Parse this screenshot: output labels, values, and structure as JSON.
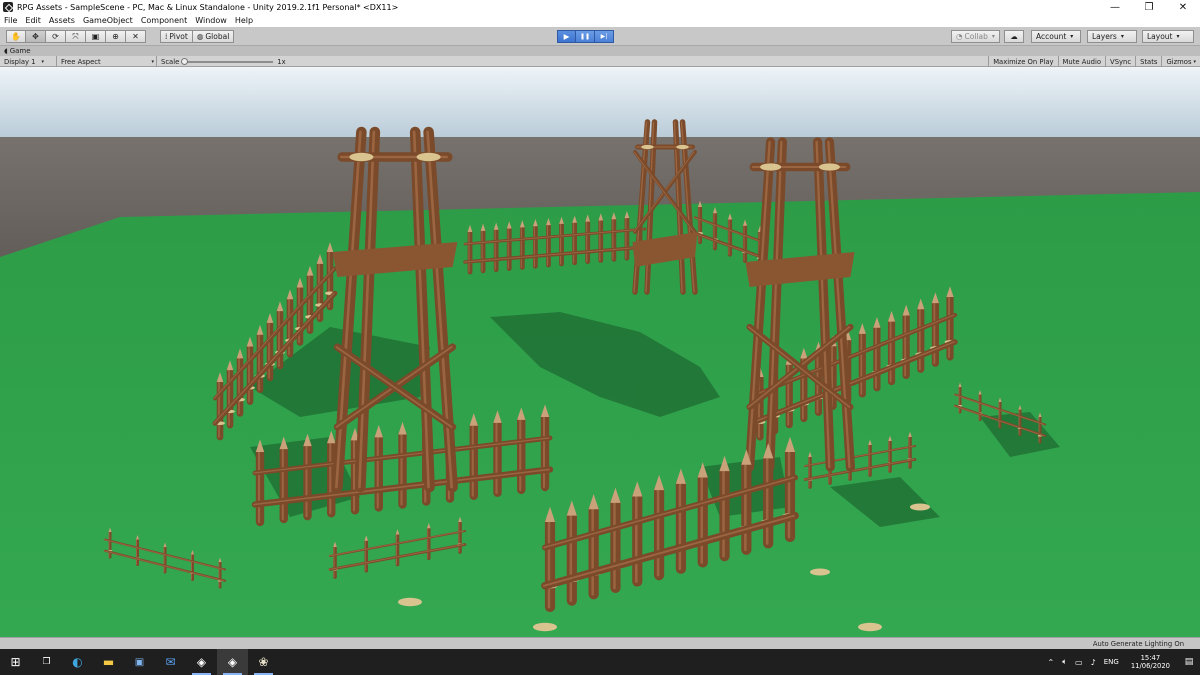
{
  "window": {
    "title": "RPG Assets - SampleScene - PC, Mac & Linux Standalone - Unity 2019.2.1f1 Personal* <DX11>",
    "controls": {
      "minimize": "—",
      "restore": "❐",
      "close": "✕"
    }
  },
  "menu": {
    "items": [
      "File",
      "Edit",
      "Assets",
      "GameObject",
      "Component",
      "Window",
      "Help"
    ]
  },
  "toolbar": {
    "tools": [
      {
        "icon": "hand-icon",
        "glyph": "✋"
      },
      {
        "icon": "move-icon",
        "glyph": "✥"
      },
      {
        "icon": "rotate-icon",
        "glyph": "⟳"
      },
      {
        "icon": "scale-icon",
        "glyph": "⤧"
      },
      {
        "icon": "rect-icon",
        "glyph": "▣"
      },
      {
        "icon": "transform-icon",
        "glyph": "⊕"
      },
      {
        "icon": "custom-tool-icon",
        "glyph": "✕"
      }
    ],
    "pivot_label": "Pivot",
    "global_label": "Global",
    "play_glyph": "▶",
    "pause_glyph": "❚❚",
    "step_glyph": "▶|",
    "collab_label": "Collab",
    "account_label": "Account",
    "layers_label": "Layers",
    "layout_label": "Layout"
  },
  "game_view": {
    "tab_label": "Game",
    "display_label": "Display 1",
    "aspect_label": "Free Aspect",
    "scale_label": "Scale",
    "scale_value": "1x",
    "scale_fraction": 0,
    "right_buttons": [
      "Maximize On Play",
      "Mute Audio",
      "VSync",
      "Stats",
      "Gizmos"
    ]
  },
  "status": {
    "text": "Auto Generate Lighting On"
  },
  "taskbar": {
    "apps": [
      {
        "icon": "windows-start-icon",
        "glyph": "⊞"
      },
      {
        "icon": "task-view-icon",
        "glyph": "❐"
      },
      {
        "icon": "edge-icon",
        "glyph": "◐"
      },
      {
        "icon": "file-explorer-icon",
        "glyph": "▬"
      },
      {
        "icon": "store-icon",
        "glyph": "▣"
      },
      {
        "icon": "mail-icon",
        "glyph": "✉"
      },
      {
        "icon": "unity-hub-icon",
        "glyph": "◈"
      },
      {
        "icon": "unity-editor-icon",
        "glyph": "◈"
      },
      {
        "icon": "blender-icon",
        "glyph": "❀"
      }
    ],
    "language": "ENG",
    "time": "15:47",
    "date": "11/06/2020"
  },
  "colors": {
    "ground": "#2fa14a",
    "wood": "#7a4a2a",
    "rope": "#d9c38f",
    "sky_top": "#b8cfe0",
    "horizon": "#6b6763",
    "accent": "#3d74cf"
  }
}
